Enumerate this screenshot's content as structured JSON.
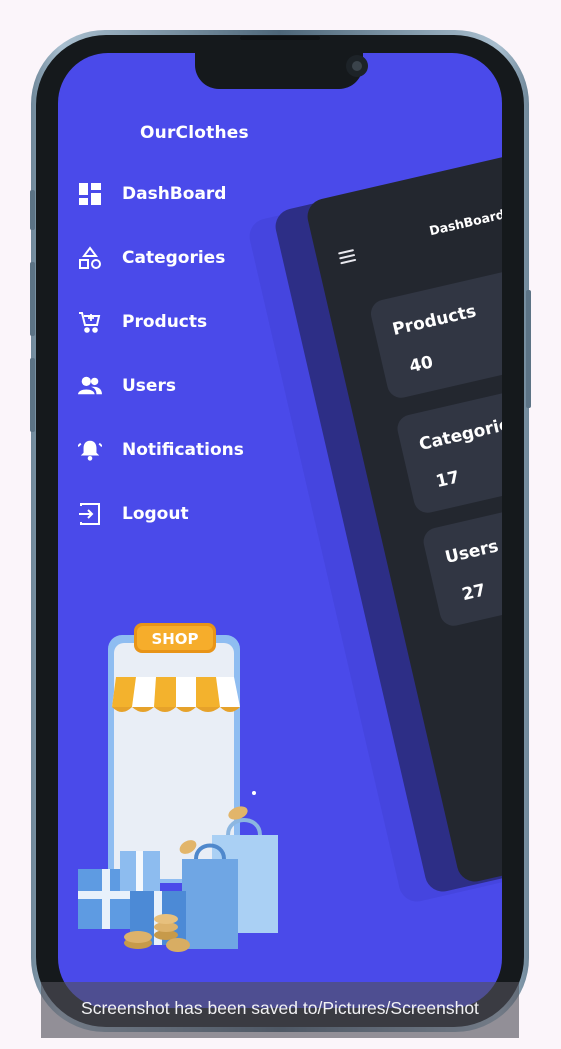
{
  "drawer": {
    "app_title": "OurClothes",
    "items": [
      {
        "label": "DashBoard",
        "icon": "dashboard-icon"
      },
      {
        "label": "Categories",
        "icon": "categories-icon"
      },
      {
        "label": "Products",
        "icon": "cart-icon"
      },
      {
        "label": "Users",
        "icon": "users-icon"
      },
      {
        "label": "Notifications",
        "icon": "bell-icon"
      },
      {
        "label": "Logout",
        "icon": "logout-icon"
      }
    ]
  },
  "preview": {
    "title": "DashBoard",
    "stats": [
      {
        "label": "Products",
        "value": "40"
      },
      {
        "label": "Categories",
        "value": "17"
      },
      {
        "label": "Users",
        "value": "27"
      }
    ]
  },
  "illustration": {
    "shop_sign": "SHOP"
  },
  "toast": {
    "message": "Screenshot has been saved to/Pictures/Screenshot"
  },
  "colors": {
    "background": "#4a4aea",
    "card_dark": "#23272f",
    "stat_card": "#313643"
  }
}
